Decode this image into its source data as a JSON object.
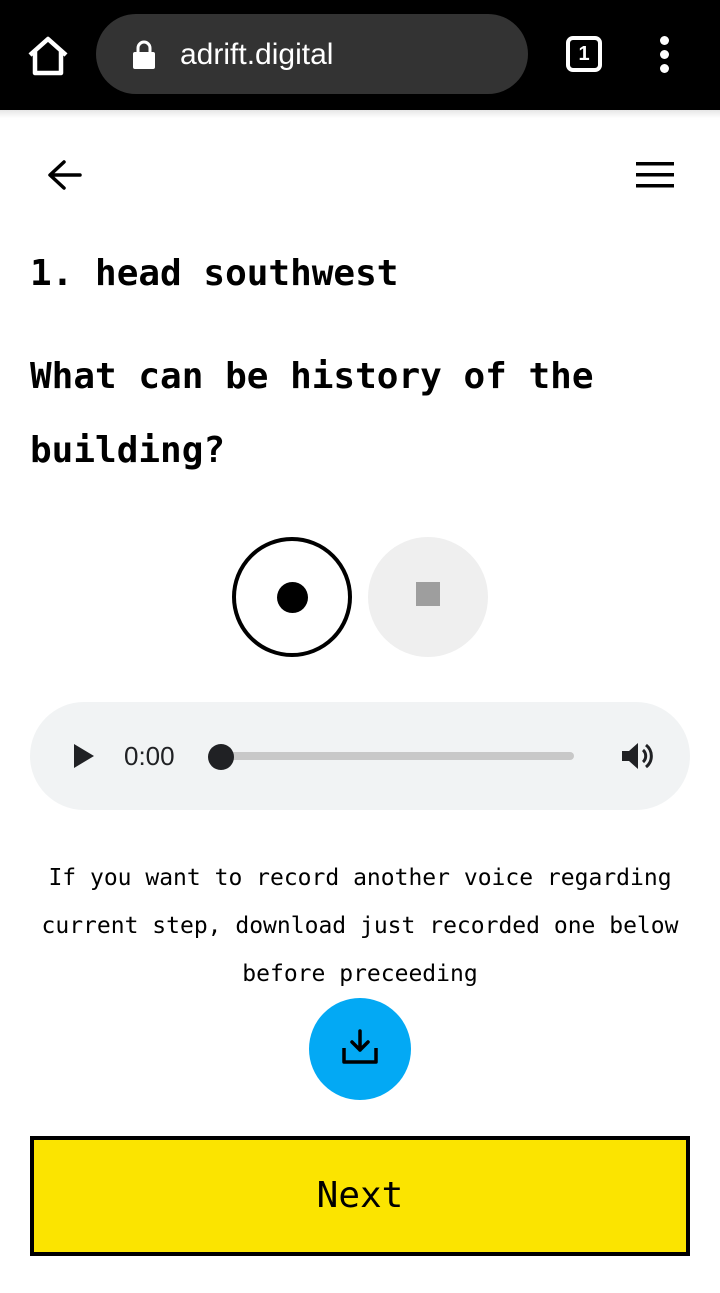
{
  "browser": {
    "url": "adrift.digital",
    "tab_count": "1"
  },
  "step": {
    "title": "1. head southwest",
    "question": "What can be history of the building?"
  },
  "player": {
    "time": "0:00",
    "progress": 0
  },
  "note": "If you want to record another voice regarding current step, download just recorded one below before preceeding",
  "buttons": {
    "next_label": "Next"
  },
  "colors": {
    "accent_blue": "#03a9f4",
    "next_yellow": "#fbe400"
  },
  "icons": {
    "home": "home-icon",
    "lock": "lock-icon",
    "back": "arrow-left-icon",
    "menu": "hamburger-icon",
    "record": "record-icon",
    "stop": "stop-icon",
    "play": "play-icon",
    "volume": "volume-icon",
    "download": "download-icon"
  }
}
